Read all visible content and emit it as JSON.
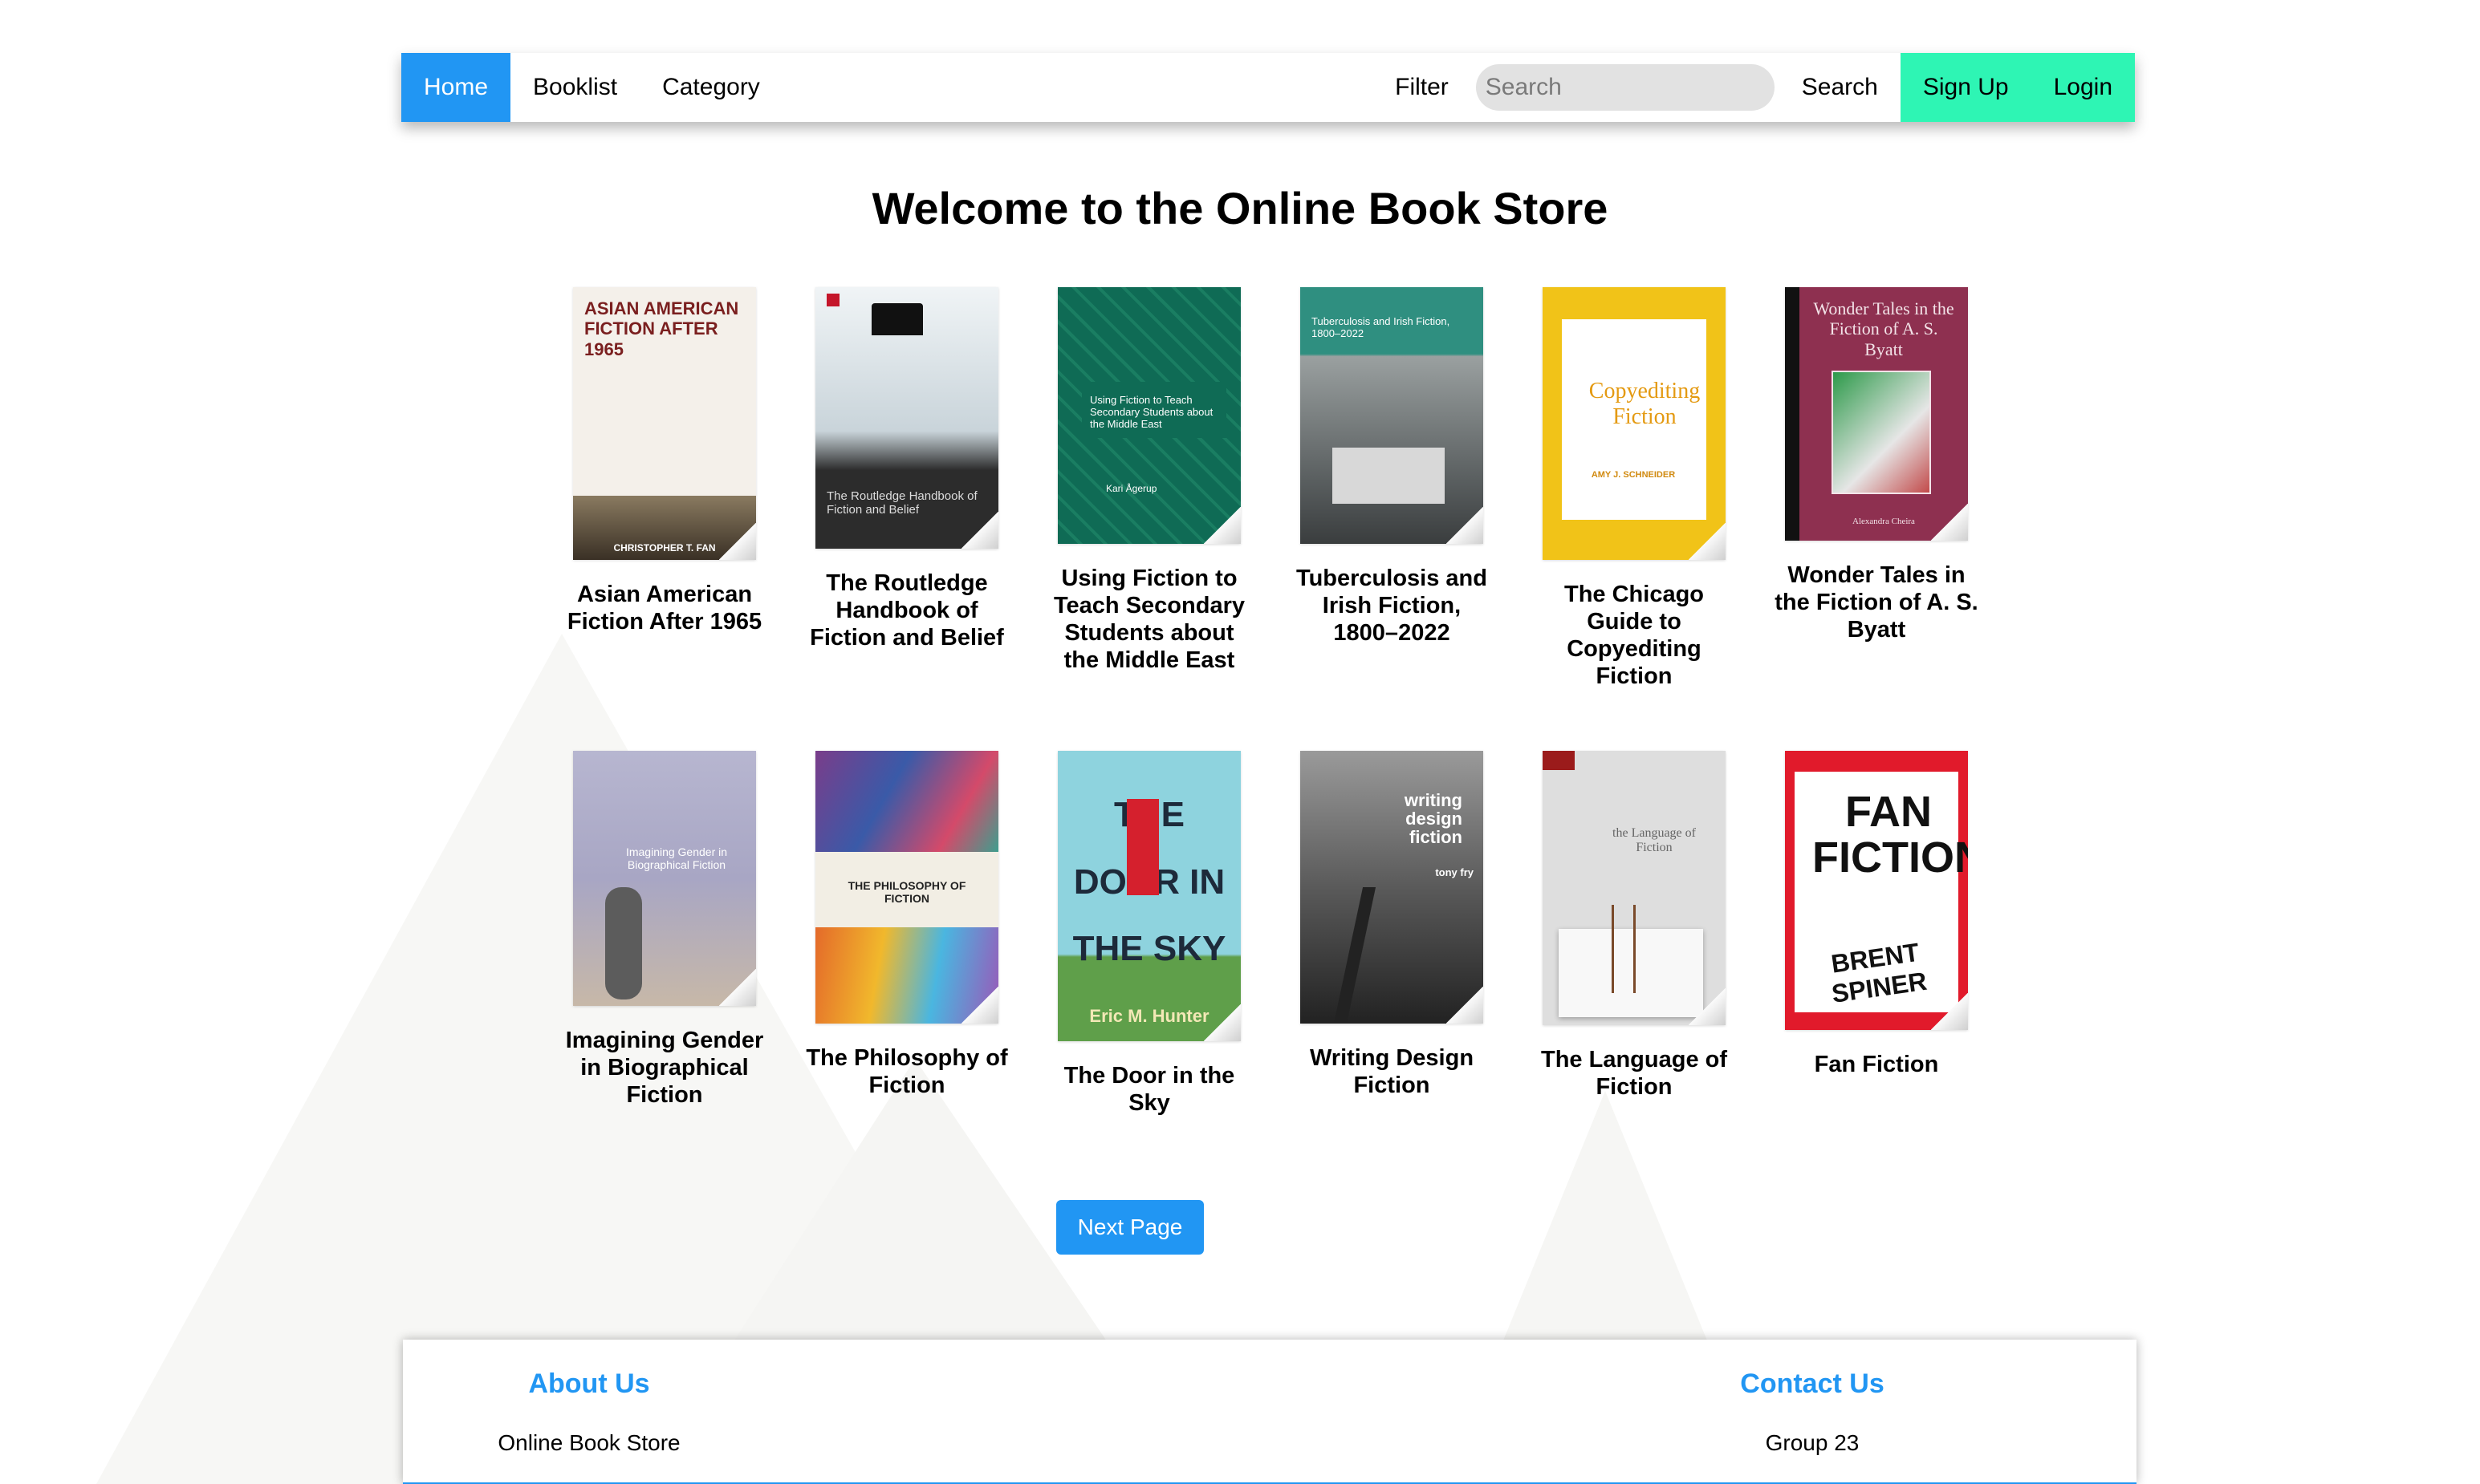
{
  "nav": {
    "home": "Home",
    "booklist": "Booklist",
    "category": "Category",
    "filter": "Filter",
    "search_placeholder": "Search",
    "search_button": "Search",
    "signup": "Sign Up",
    "login": "Login",
    "active_color": "#2196F3",
    "auth_color": "#2ef5b4"
  },
  "page_title": "Welcome to the Online Book Store",
  "books": [
    {
      "title": "Asian American Fiction After 1965",
      "cover_text": "ASIAN AMERICAN FICTION AFTER 1965",
      "cover_author": "CHRISTOPHER T. FAN",
      "cover_color": "#f4f0ea"
    },
    {
      "title": "The Routledge Handbook of Fiction and Belief",
      "cover_text": "The Routledge Handbook of Fiction and Belief",
      "cover_author": "",
      "cover_color": "#2c2c2c"
    },
    {
      "title": "Using Fiction to Teach Secondary Students about the Middle East",
      "cover_text": "Using Fiction to Teach Secondary Students about the Middle East",
      "cover_author": "Kari Ågerup",
      "cover_color": "#0f6b55"
    },
    {
      "title": "Tuberculosis and Irish Fiction, 1800–2022",
      "cover_text": "Tuberculosis and Irish Fiction, 1800–2022",
      "cover_author": "",
      "cover_color": "#2f8f80"
    },
    {
      "title": "The Chicago Guide to Copyediting Fiction",
      "cover_text": "Copyediting Fiction",
      "cover_author": "AMY J. SCHNEIDER",
      "cover_color": "#f1c318"
    },
    {
      "title": "Wonder Tales in the Fiction of A. S. Byatt",
      "cover_text": "Wonder Tales in the Fiction of A. S. Byatt",
      "cover_author": "Alexandra Cheira",
      "cover_color": "#8e3050"
    },
    {
      "title": "Imagining Gender in Biographical Fiction",
      "cover_text": "Imagining Gender in Biographical Fiction",
      "cover_author": "",
      "cover_color": "#a8a6c4"
    },
    {
      "title": "The Philosophy of Fiction",
      "cover_text": "THE PHILOSOPHY OF FICTION",
      "cover_author": "",
      "cover_color": "#f2eee4"
    },
    {
      "title": "The Door in the Sky",
      "cover_text": "THE DOOR IN THE SKY",
      "cover_author": "Eric M. Hunter",
      "cover_color": "#8ed3de"
    },
    {
      "title": "Writing Design Fiction",
      "cover_text": "writing design fiction",
      "cover_author": "tony fry",
      "cover_color": "#555555"
    },
    {
      "title": "The Language of Fiction",
      "cover_text": "the Language of Fiction",
      "cover_author": "",
      "cover_color": "#dedede"
    },
    {
      "title": "Fan Fiction",
      "cover_text": "FAN FICTION",
      "cover_author": "BRENT SPINER",
      "cover_color": "#e11a2b"
    }
  ],
  "next_page": "Next Page",
  "footer": {
    "about_heading": "About Us",
    "about_text": "Online Book Store",
    "contact_heading": "Contact Us",
    "contact_text": "Group 23",
    "heading_color": "#2196F3"
  }
}
